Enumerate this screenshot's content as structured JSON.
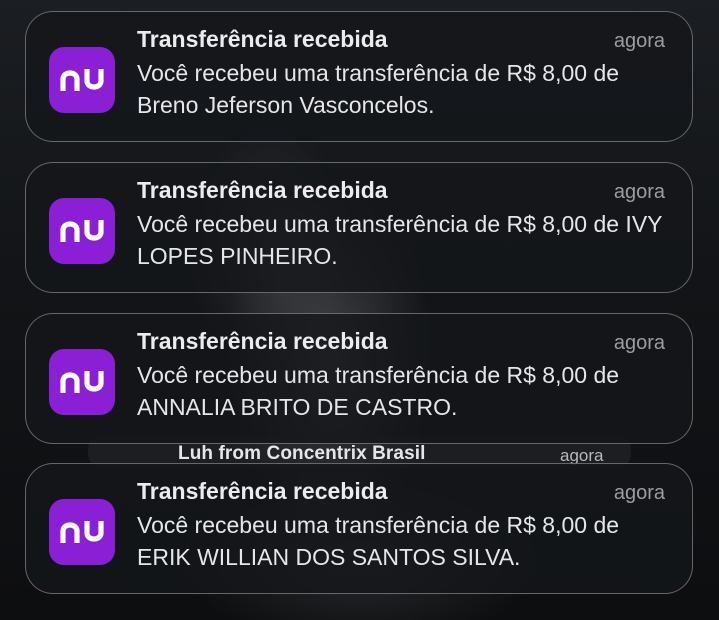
{
  "background_notification": {
    "title": "Luh from Concentrix Brasil",
    "time": "agora"
  },
  "notifications": [
    {
      "app_icon": "nubank-logo-icon",
      "title": "Transferência recebida",
      "time": "agora",
      "body": "Você recebeu uma transferência de R$ 8,00 de Breno Jeferson Vasconcelos."
    },
    {
      "app_icon": "nubank-logo-icon",
      "title": "Transferência recebida",
      "time": "agora",
      "body": "Você recebeu uma transferência de R$ 8,00 de IVY LOPES PINHEIRO."
    },
    {
      "app_icon": "nubank-logo-icon",
      "title": "Transferência recebida",
      "time": "agora",
      "body": "Você recebeu uma transferência de R$ 8,00 de ANNALIA BRITO DE CASTRO."
    },
    {
      "app_icon": "nubank-logo-icon",
      "title": "Transferência recebida",
      "time": "agora",
      "body": "Você recebeu uma transferência de R$ 8,00 de ERIK WILLIAN DOS SANTOS SILVA."
    }
  ],
  "colors": {
    "nubank_purple": "#8a1fd6",
    "card_background": "#14161a",
    "title_text": "#ececee",
    "time_text": "#9c9ca2"
  }
}
